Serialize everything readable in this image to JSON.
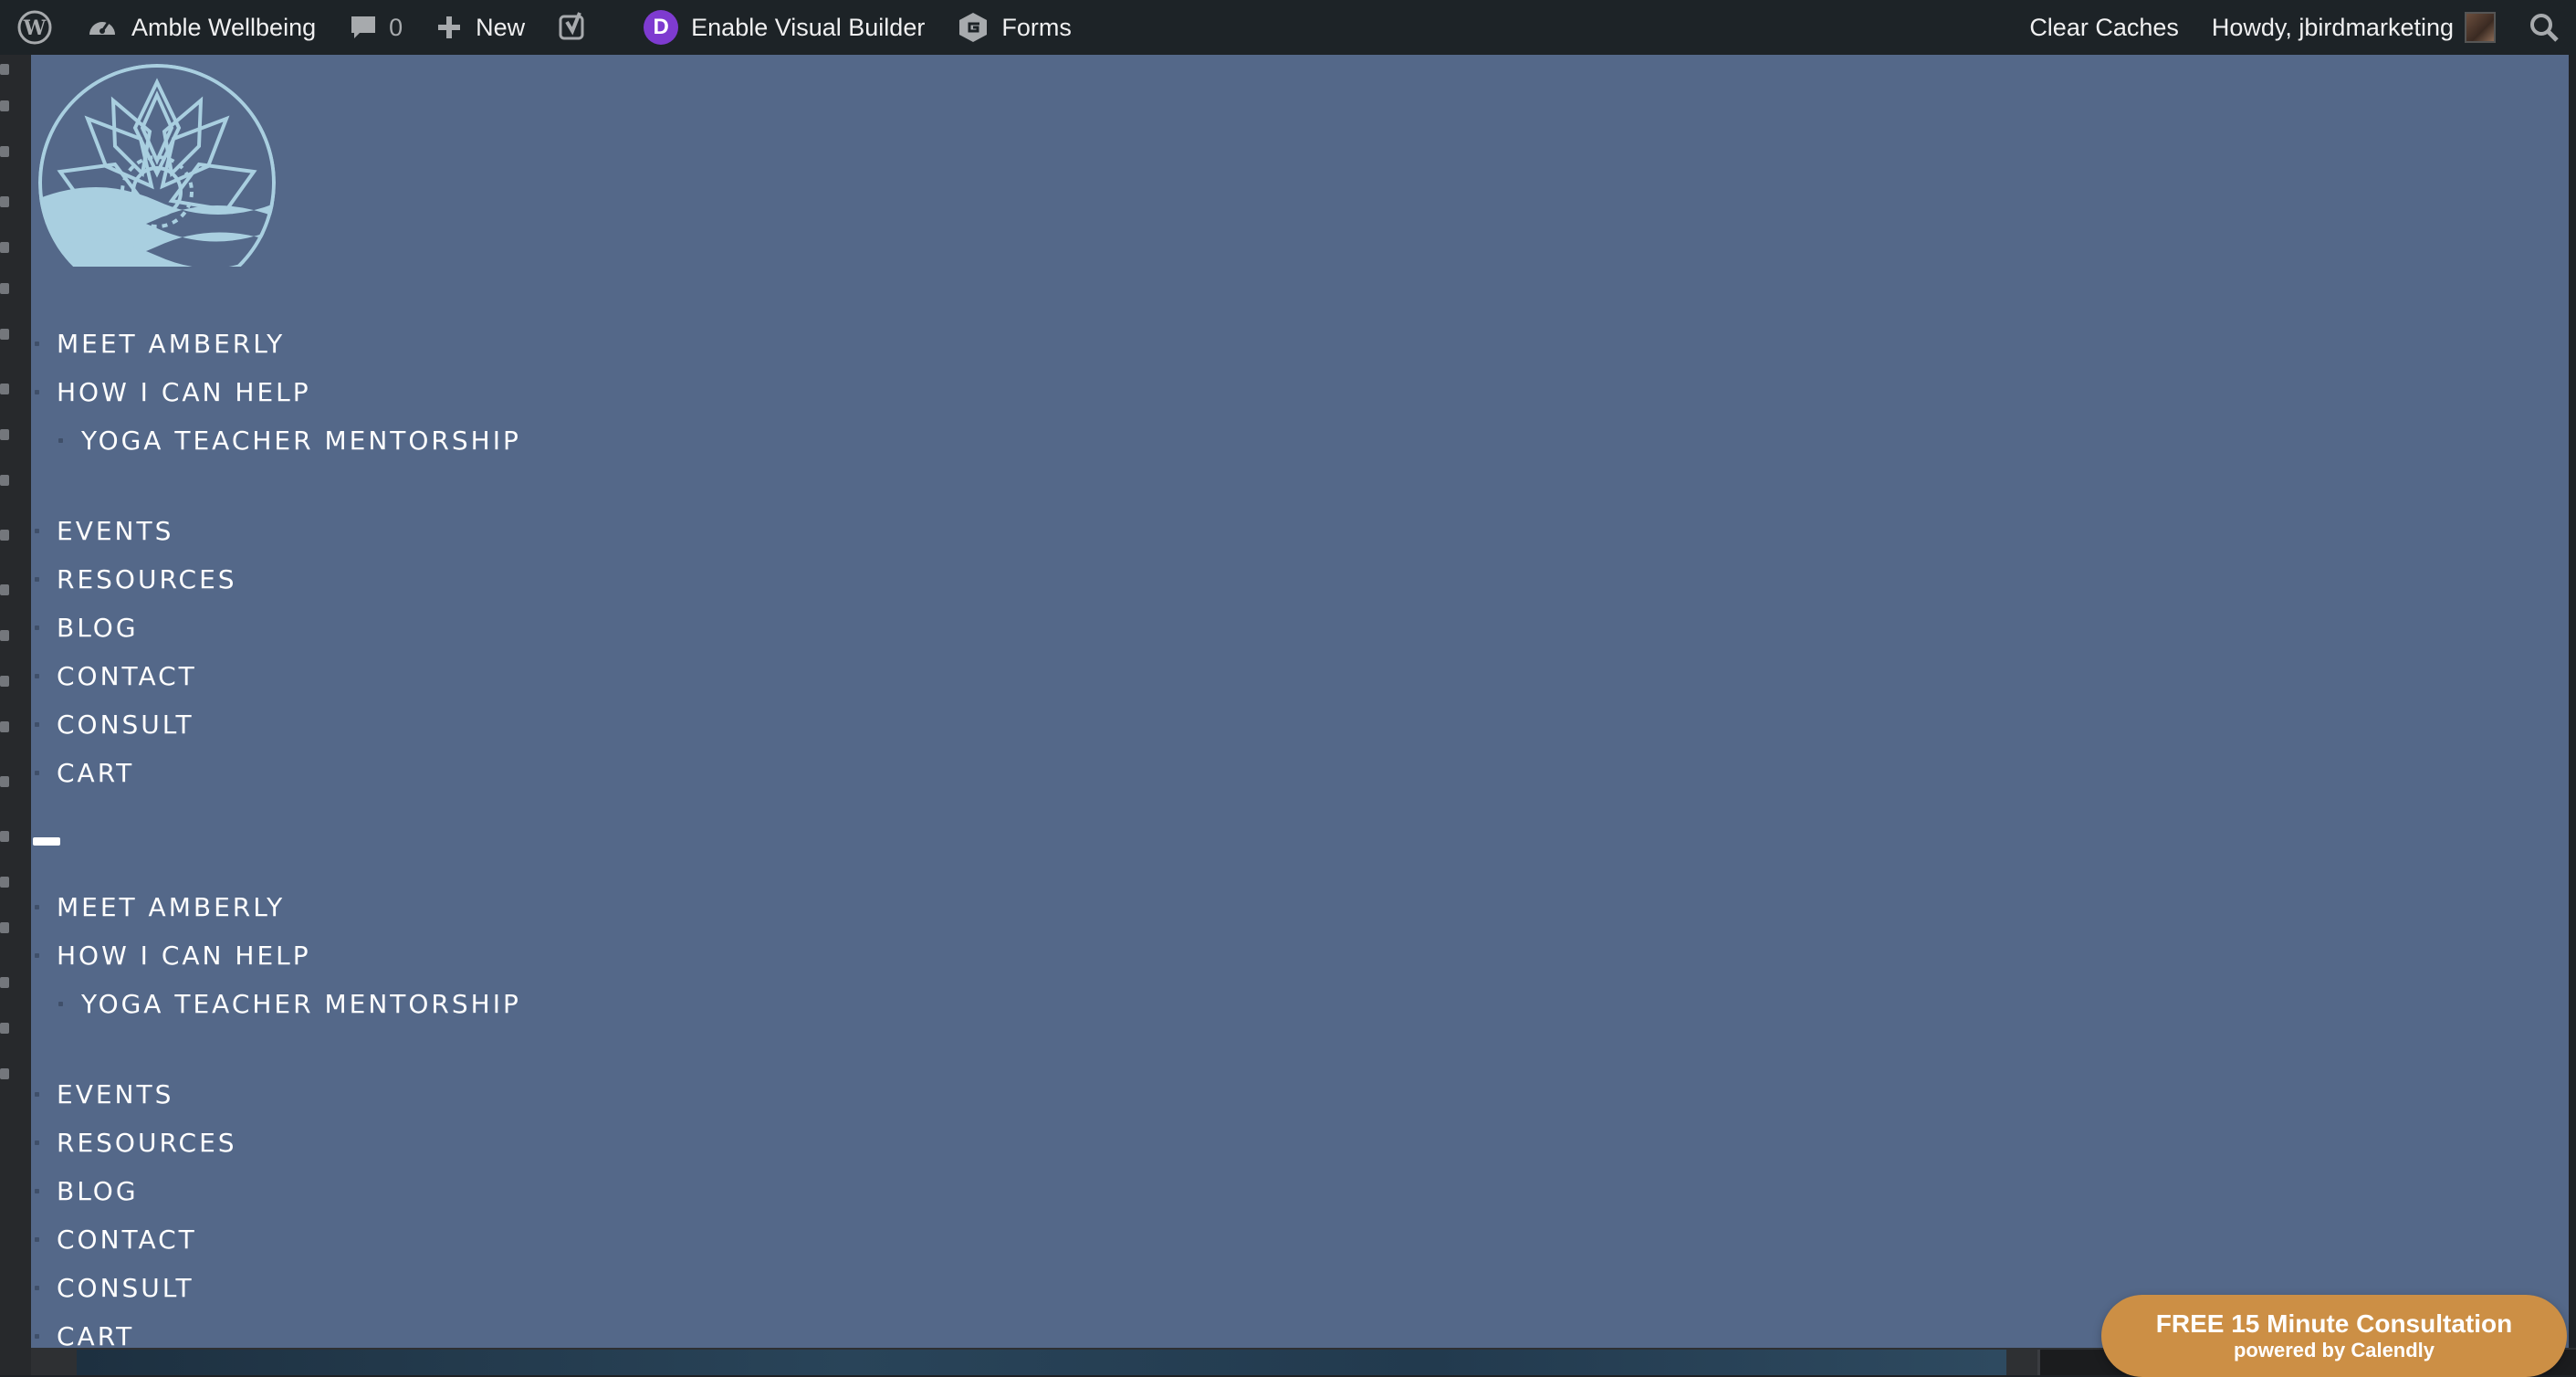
{
  "admin_bar": {
    "site_name": "Amble Wellbeing",
    "comments_count": "0",
    "new_label": "New",
    "visual_builder_label": "Enable Visual Builder",
    "divi_letter": "D",
    "forms_label": "Forms",
    "clear_caches_label": "Clear Caches",
    "howdy_label": "Howdy, jbirdmarketing"
  },
  "menu_primary": {
    "items": [
      {
        "label": "MEET AMBERLY"
      },
      {
        "label": "HOW I CAN HELP"
      },
      {
        "label": "YOGA TEACHER MENTORSHIP"
      },
      {
        "label": "EVENTS"
      },
      {
        "label": "RESOURCES"
      },
      {
        "label": "BLOG"
      },
      {
        "label": "CONTACT"
      },
      {
        "label": "CONSULT"
      },
      {
        "label": "CART"
      }
    ]
  },
  "menu_secondary": {
    "items": [
      {
        "label": "MEET AMBERLY"
      },
      {
        "label": "HOW I CAN HELP"
      },
      {
        "label": "YOGA TEACHER MENTORSHIP"
      },
      {
        "label": "EVENTS"
      },
      {
        "label": "RESOURCES"
      },
      {
        "label": "BLOG"
      },
      {
        "label": "CONTACT"
      },
      {
        "label": "CONSULT"
      },
      {
        "label": "CART"
      }
    ]
  },
  "calendly": {
    "title": "FREE 15 Minute Consultation",
    "subtitle": "powered by Calendly"
  },
  "colors": {
    "admin_bar": "#1d2327",
    "page_background": "#546889",
    "logo": "#a9cfe0",
    "calendly_badge": "#cc8f45",
    "divi_badge": "#7e3bd0"
  },
  "icons": {
    "wordpress": "wordpress-logo-icon",
    "dashboard": "dashboard-gauge-icon",
    "comments": "comment-bubble-icon",
    "new": "plus-icon",
    "yoast": "yoast-seo-icon",
    "forms": "gravity-forms-icon",
    "search": "search-icon"
  }
}
